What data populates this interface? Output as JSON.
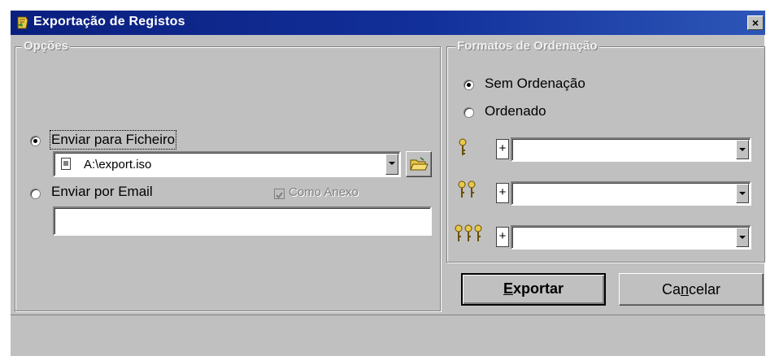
{
  "window": {
    "title": "Exportação de Registos",
    "close_label": "×"
  },
  "options_group": {
    "legend": "Opções",
    "send_to_file": {
      "label": "Enviar para Ficheiro",
      "selected": true
    },
    "file_combo": {
      "value": "A:\\export.iso"
    },
    "send_by_email": {
      "label": "Enviar por Email",
      "selected": false
    },
    "as_attachment": {
      "label": "Como Anexo",
      "checked": true,
      "enabled": false
    },
    "email_field": {
      "value": ""
    }
  },
  "sort_group": {
    "legend": "Formatos de Ordenação",
    "no_sort": {
      "label": "Sem Ordenação",
      "selected": true
    },
    "sorted": {
      "label": "Ordenado",
      "selected": false
    },
    "sort_rows": [
      {
        "keys_icon": "single-key-icon",
        "plus": "+",
        "value": ""
      },
      {
        "keys_icon": "double-key-icon",
        "plus": "+",
        "value": ""
      },
      {
        "keys_icon": "triple-key-icon",
        "plus": "+",
        "value": ""
      }
    ]
  },
  "buttons": {
    "export": {
      "prefix": "",
      "accel": "E",
      "suffix": "xportar"
    },
    "cancel": {
      "prefix": "Ca",
      "accel": "n",
      "suffix": "celar"
    }
  },
  "icons": [
    "app-icon",
    "close-icon",
    "file-icon",
    "open-folder-icon",
    "key-icon"
  ],
  "colors": {
    "titlebar": "#0a1f7e",
    "legend_text": "#f0f0f0",
    "face": "#c0c0c0"
  }
}
